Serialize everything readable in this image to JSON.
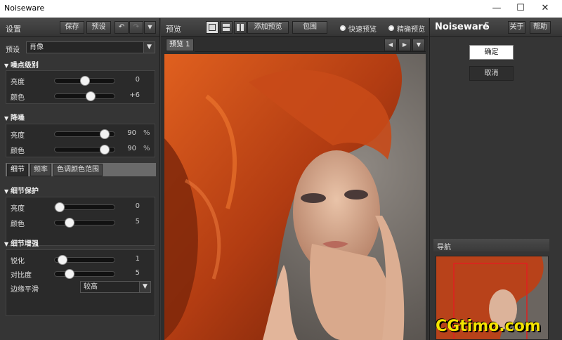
{
  "window": {
    "title": "Noiseware",
    "minimize": "—",
    "maximize": "☐",
    "close": "✕"
  },
  "left": {
    "header": "设置",
    "save": "保存",
    "preset_btn": "预设",
    "undo": "↶",
    "redo": "↷",
    "menu": "▼",
    "preset_label": "预设",
    "preset_value": "肖像",
    "noise_level": {
      "title": "噪点级别",
      "rows": [
        {
          "label": "亮度",
          "value": "0",
          "unit": "",
          "level": 0.5
        },
        {
          "label": "颜色",
          "value": "+6",
          "unit": "",
          "level": 0.62
        }
      ]
    },
    "noise_reduction": {
      "title": "降噪",
      "rows": [
        {
          "label": "亮度",
          "value": "90",
          "unit": "%",
          "level": 0.9
        },
        {
          "label": "颜色",
          "value": "90",
          "unit": "%",
          "level": 0.9
        }
      ]
    },
    "tabs": [
      "细节",
      "频率",
      "色调颜色范围"
    ],
    "detail_protect": {
      "title": "细节保护",
      "rows": [
        {
          "label": "亮度",
          "value": "0",
          "unit": "",
          "level": 0
        },
        {
          "label": "颜色",
          "value": "5",
          "unit": "",
          "level": 0.2
        }
      ]
    },
    "detail_enhance": {
      "title": "细节增强",
      "rows": [
        {
          "label": "锐化",
          "value": "1",
          "unit": "",
          "level": 0.05
        },
        {
          "label": "对比度",
          "value": "5",
          "unit": "",
          "level": 0.2
        }
      ],
      "edge_label": "边缘平滑",
      "edge_value": "较高"
    }
  },
  "center": {
    "header": "预览",
    "add_preview": "添加预览",
    "wrap": "包围",
    "fast_preview": "快速预览",
    "precise_preview": "精确预览",
    "tab": "预览 1",
    "prev": "◀",
    "next": "▶",
    "more": "▼"
  },
  "right": {
    "logo_main": "Noiseware",
    "logo_ver": "5",
    "about": "关于",
    "help": "帮助",
    "ok": "确定",
    "cancel": "取消",
    "nav": "导航"
  },
  "watermark": "CGtimo.com",
  "colors": {
    "hair": "#c8461a",
    "bg": "#6b6560"
  }
}
